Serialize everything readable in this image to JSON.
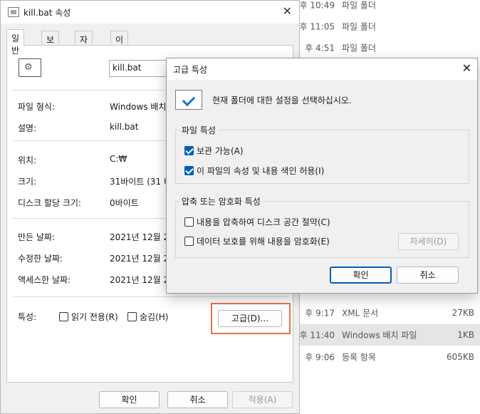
{
  "background_list": [
    {
      "time": "후 10:49",
      "type": "파일 폴더",
      "size": ""
    },
    {
      "time": "후 11:05",
      "type": "파일 폴더",
      "size": ""
    },
    {
      "time": "후 4:51",
      "type": "파일 폴더",
      "size": ""
    },
    {
      "time": "후 9:17",
      "type": "XML 문서",
      "size": "27KB"
    },
    {
      "time": "후 11:40",
      "type": "Windows 배치 파일",
      "size": "1KB"
    },
    {
      "time": "후 9:06",
      "type": "등록 항목",
      "size": "605KB"
    }
  ],
  "props": {
    "title": "kill.bat 속성",
    "tabs": [
      "일반",
      "보안",
      "자세히",
      "이전 버전"
    ],
    "filename": "kill.bat",
    "rows": {
      "file_type_label": "파일 형식:",
      "file_type_value": "Windows 배치",
      "desc_label": "설명:",
      "desc_value": "kill.bat",
      "location_label": "위치:",
      "location_value": "C:₩",
      "size_label": "크기:",
      "size_value": "31바이트 (31 비",
      "disk_label": "디스크 할당 크기:",
      "disk_value": "0바이트",
      "created_label": "만든 날짜:",
      "created_value": "2021년 12월 2",
      "modified_label": "수정한 날짜:",
      "modified_value": "2021년 12월 2",
      "accessed_label": "액세스한 날짜:",
      "accessed_value": "2021년 12월 2"
    },
    "attributes_label": "특성:",
    "readonly_label": "읽기 전용(R)",
    "hidden_label": "숨김(H)",
    "advanced_button": "고급(D)...",
    "ok": "확인",
    "cancel": "취소",
    "apply": "적용(A)"
  },
  "adv": {
    "title": "고급 특성",
    "info": "현재 폴더에 대한 설정을 선택하십시오.",
    "file_group": "파일 특성",
    "archive": "보관 가능(A)",
    "index": "이 파일의 속성 및 내용 색인 허용(I)",
    "compress_group": "압축 또는 암호화 특성",
    "compress": "내용을 압축하여 디스크 공간 절약(C)",
    "encrypt": "데이터 보호를 위해 내용을 암호화(E)",
    "details": "자세히(D)",
    "ok": "확인",
    "cancel": "취소"
  },
  "colors": {
    "accent": "#005fb8",
    "highlight": "#e8734a"
  }
}
